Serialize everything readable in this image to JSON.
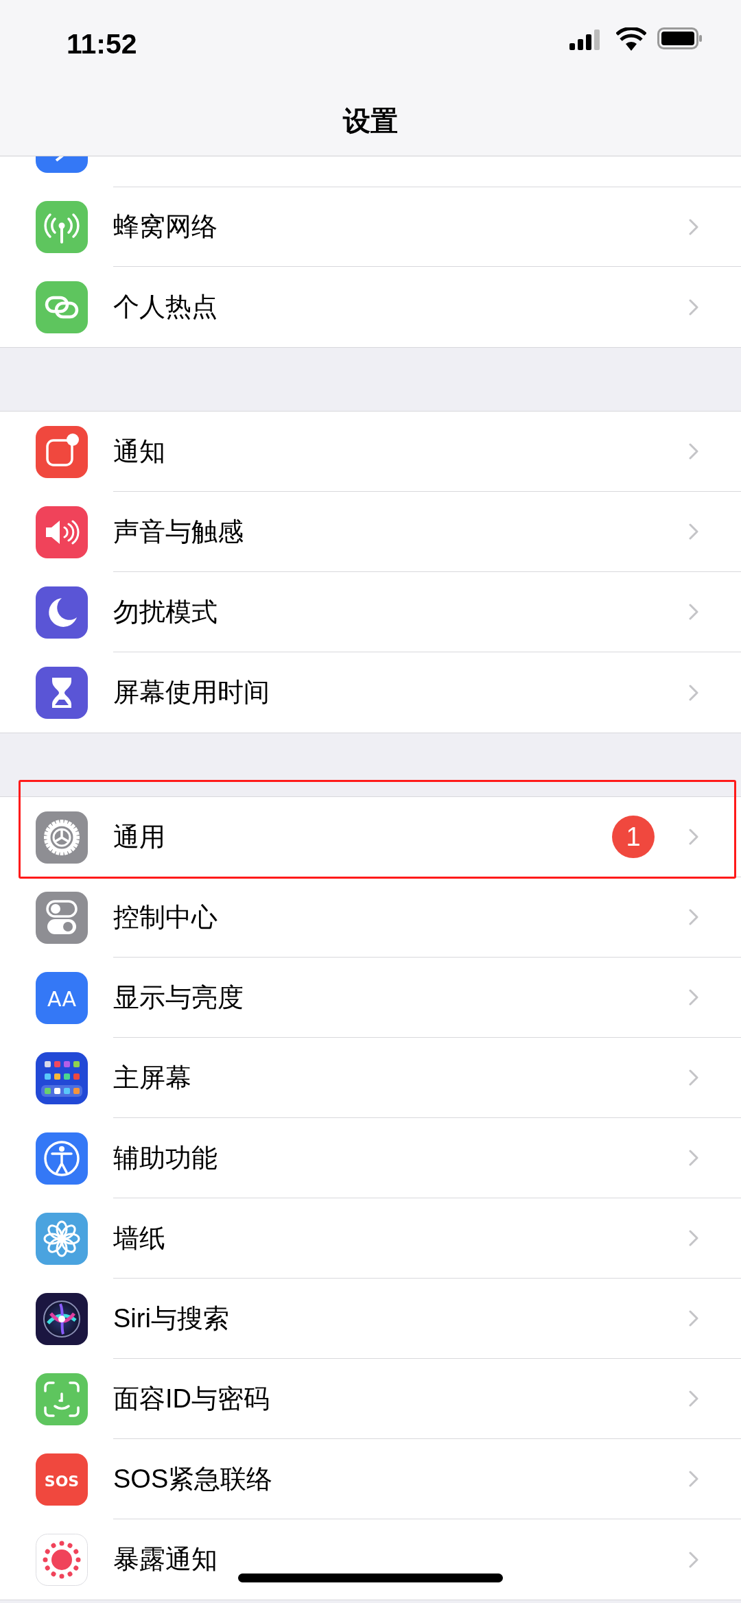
{
  "status_bar": {
    "time": "11:52"
  },
  "nav": {
    "title": "设置"
  },
  "groups": [
    {
      "items": [
        {
          "label": "蜂窝网络"
        },
        {
          "label": "个人热点"
        }
      ]
    },
    {
      "items": [
        {
          "label": "通知"
        },
        {
          "label": "声音与触感"
        },
        {
          "label": "勿扰模式"
        },
        {
          "label": "屏幕使用时间"
        }
      ]
    },
    {
      "items": [
        {
          "label": "通用",
          "badge": "1",
          "highlighted": true
        },
        {
          "label": "控制中心",
          "highlighted": false
        },
        {
          "label": "显示与亮度",
          "icon_label": "AA",
          "highlighted": false
        },
        {
          "label": "主屏幕",
          "highlighted": false
        },
        {
          "label": "辅助功能",
          "highlighted": false
        },
        {
          "label": "墙纸",
          "highlighted": false
        },
        {
          "label": "Siri与搜索",
          "highlighted": false
        },
        {
          "label": "面容ID与密码",
          "highlighted": false
        },
        {
          "label": "SOS紧急联络",
          "icon_label": "SOS",
          "highlighted": false
        },
        {
          "label": "暴露通知",
          "highlighted": false
        }
      ]
    }
  ]
}
